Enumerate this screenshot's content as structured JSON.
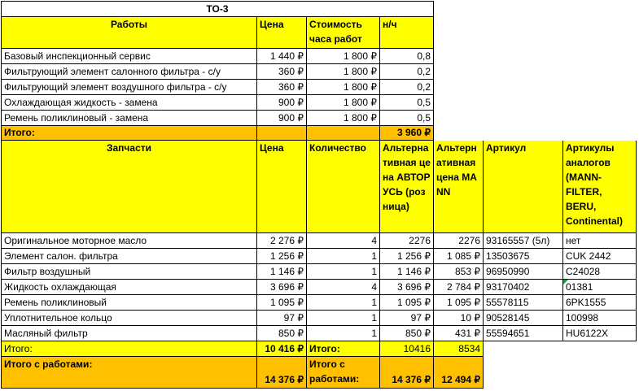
{
  "title": "ТО-3",
  "works": {
    "headers": {
      "name": "Работы",
      "price": "Цена",
      "hour_cost": "Стоимость часа работ",
      "norm": "н/ч"
    },
    "rows": [
      {
        "name": "Базовый инспекционный сервис",
        "price": "1 440 ₽",
        "hour_cost": "1 800 ₽",
        "norm": "0,8"
      },
      {
        "name": "Фильтрующий элемент салонного фильтра - с/у",
        "price": "360 ₽",
        "hour_cost": "1 800 ₽",
        "norm": "0,2"
      },
      {
        "name": "Фильтрующий элемент воздушного фильтра - с/у",
        "price": "360 ₽",
        "hour_cost": "1 800 ₽",
        "norm": "0,2"
      },
      {
        "name": "Охлаждающая жидкость - замена",
        "price": "900 ₽",
        "hour_cost": "1 800 ₽",
        "norm": "0,5"
      },
      {
        "name": "Ремень поликлиновый - замена",
        "price": "900 ₽",
        "hour_cost": "1 800 ₽",
        "norm": "0,5"
      }
    ],
    "total_label": "Итого:",
    "total_value": "3 960 ₽"
  },
  "parts": {
    "headers": {
      "name": "Запчасти",
      "price": "Цена",
      "qty": "Количество",
      "alt_avtorus": "Альтернативная цена АВТОРУСЬ (розница)",
      "alt_mann": "Альтернативная цена MANN",
      "article": "Артикул",
      "analogs": "Артикулы аналогов (MANN-FILTER, BERU, Continental)"
    },
    "rows": [
      {
        "name": "Оригинальное моторное масло",
        "price": "2 276 ₽",
        "qty": "4",
        "alt_avtorus": "2276",
        "alt_mann": "2276",
        "article": "93165557 (5л)",
        "analog": "нет"
      },
      {
        "name": "Элемент салон. фильтра",
        "price": "1 256 ₽",
        "qty": "1",
        "alt_avtorus": "1 256 ₽",
        "alt_mann": "1 085 ₽",
        "article": "13503675",
        "analog": "CUK 2442"
      },
      {
        "name": "Фильтр воздушный",
        "price": "1 146 ₽",
        "qty": "1",
        "alt_avtorus": "1 146 ₽",
        "alt_mann": "853 ₽",
        "article": "96950990",
        "analog": "C24028"
      },
      {
        "name": "Жидкость охлаждающая",
        "price": "3 696 ₽",
        "qty": "4",
        "alt_avtorus": "3 696 ₽",
        "alt_mann": "2 784 ₽",
        "article": "93170402",
        "analog": "01381"
      },
      {
        "name": "Ремень поликлиновый",
        "price": "1 095 ₽",
        "qty": "1",
        "alt_avtorus": "1 095 ₽",
        "alt_mann": "1 095 ₽",
        "article": "55578115",
        "analog": "6PK1555"
      },
      {
        "name": "Уплотнительное кольцо",
        "price": "97 ₽",
        "qty": "1",
        "alt_avtorus": "97 ₽",
        "alt_mann": "10 ₽",
        "article": "90528145",
        "analog": "100998"
      },
      {
        "name": "Масляный фильтр",
        "price": "850 ₽",
        "qty": "1",
        "alt_avtorus": "850 ₽",
        "alt_mann": "431 ₽",
        "article": "55594651",
        "analog": "HU6122X"
      }
    ],
    "total_label": "Итого:",
    "total_price": "10 416 ₽",
    "total_label2": "Итого:",
    "total_alt_avtorus": "10416",
    "total_alt_mann": "8534"
  },
  "grand": {
    "label": "Итого с работами:",
    "price": "14 376 ₽",
    "label2": "Итого с работами:",
    "alt_avtorus": "14 376 ₽",
    "alt_mann": "12 494 ₽"
  },
  "colors": {
    "header_yellow": "#ffff00",
    "total_orange": "#ffc000",
    "comment_marker": "#1e9e3a"
  }
}
